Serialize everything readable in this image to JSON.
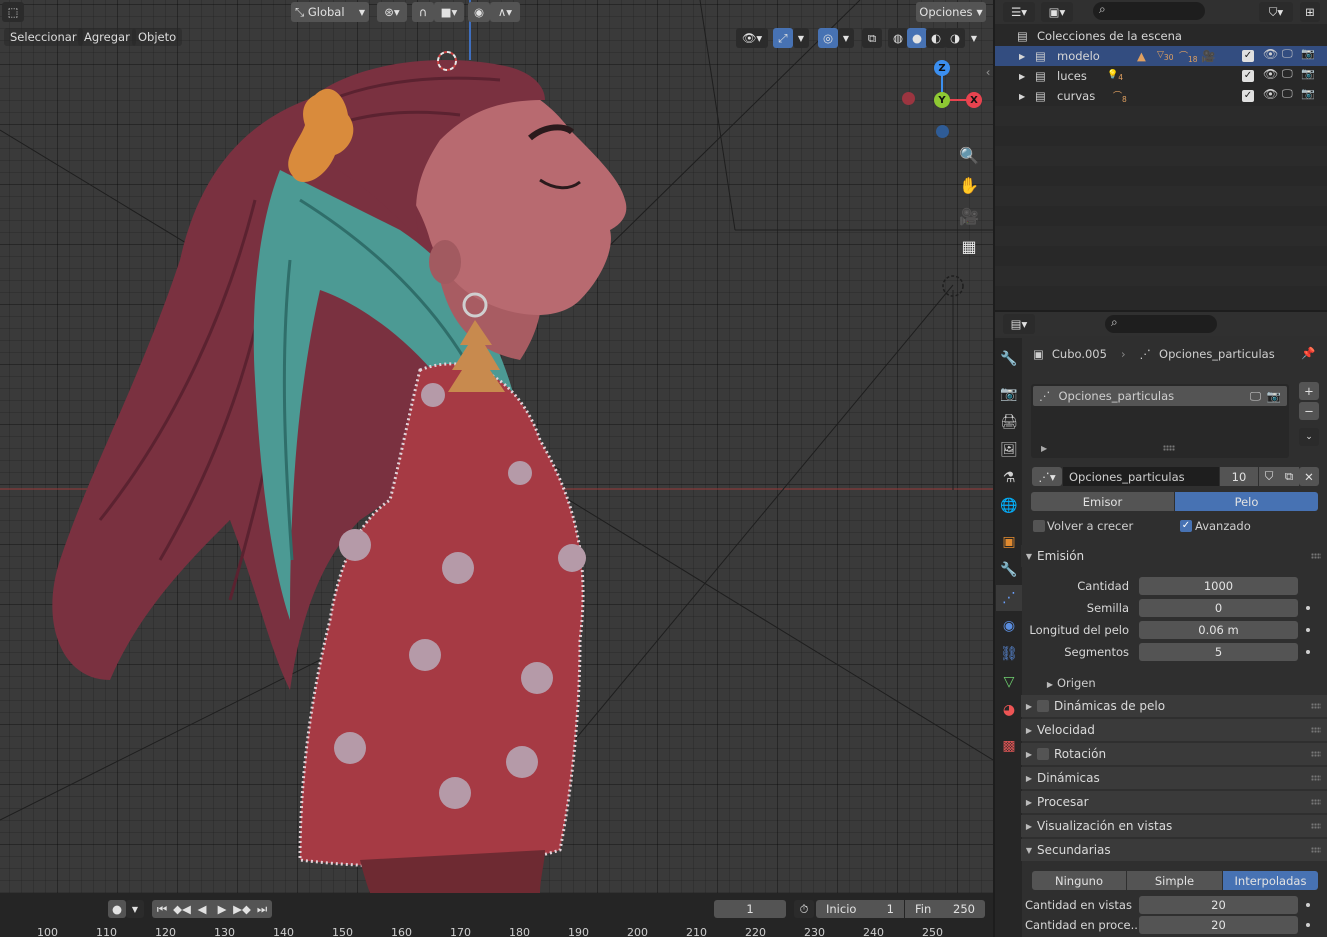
{
  "header": {
    "menu": {
      "select": "Seleccionar",
      "add": "Agregar",
      "object": "Objeto"
    },
    "transform_orientation": "Global",
    "options": "Opciones"
  },
  "gizmo": {
    "z": "Z",
    "y": "Y",
    "x": "X"
  },
  "outliner": {
    "scene_collection": "Colecciones de la escena",
    "rows": [
      {
        "name": "modelo",
        "count_a": "30",
        "count_b": "18",
        "selected": true
      },
      {
        "name": "luces",
        "count_a": "4",
        "selected": false
      },
      {
        "name": "curvas",
        "count_a": "8",
        "selected": false
      }
    ]
  },
  "properties": {
    "breadcrumb": {
      "object": "Cubo.005",
      "settings": "Opciones_particulas"
    },
    "list_item": "Opciones_particulas",
    "datablock": {
      "name": "Opciones_particulas",
      "users": "10"
    },
    "type_tabs": {
      "emitter": "Emisor",
      "hair": "Pelo",
      "active": "hair"
    },
    "regrow": {
      "label": "Volver a crecer",
      "checked": false
    },
    "advanced": {
      "label": "Avanzado",
      "checked": true
    },
    "emission": {
      "title": "Emisión",
      "fields": [
        {
          "label": "Cantidad",
          "value": "1000"
        },
        {
          "label": "Semilla",
          "value": "0"
        },
        {
          "label": "Longitud del pelo",
          "value": "0.06 m"
        },
        {
          "label": "Segmentos",
          "value": "5"
        }
      ],
      "source": "Origen"
    },
    "panels": [
      {
        "title": "Dinámicas de pelo",
        "checkbox": true
      },
      {
        "title": "Velocidad",
        "checkbox": false
      },
      {
        "title": "Rotación",
        "checkbox": true
      },
      {
        "title": "Dinámicas",
        "checkbox": false
      },
      {
        "title": "Procesar",
        "checkbox": false
      },
      {
        "title": "Visualización en vistas",
        "checkbox": false
      }
    ],
    "children": {
      "title": "Secundarias",
      "tabs": [
        "Ninguno",
        "Simple",
        "Interpoladas"
      ],
      "active": "Interpoladas",
      "fields": [
        {
          "label": "Cantidad en vistas",
          "value": "20"
        },
        {
          "label": "Cantidad en proce...",
          "value": "20"
        }
      ]
    }
  },
  "timeline": {
    "current_frame": "1",
    "start_label": "Inicio",
    "start": "1",
    "end_label": "Fin",
    "end": "250",
    "ticks": [
      "100",
      "110",
      "120",
      "130",
      "140",
      "150",
      "160",
      "170",
      "180",
      "190",
      "200",
      "210",
      "220",
      "230",
      "240",
      "250"
    ]
  },
  "colors": {
    "accent": "#4772b3",
    "x_axis": "#e8434f",
    "y_axis": "#8ec933",
    "z_axis": "#3b8ff0"
  }
}
